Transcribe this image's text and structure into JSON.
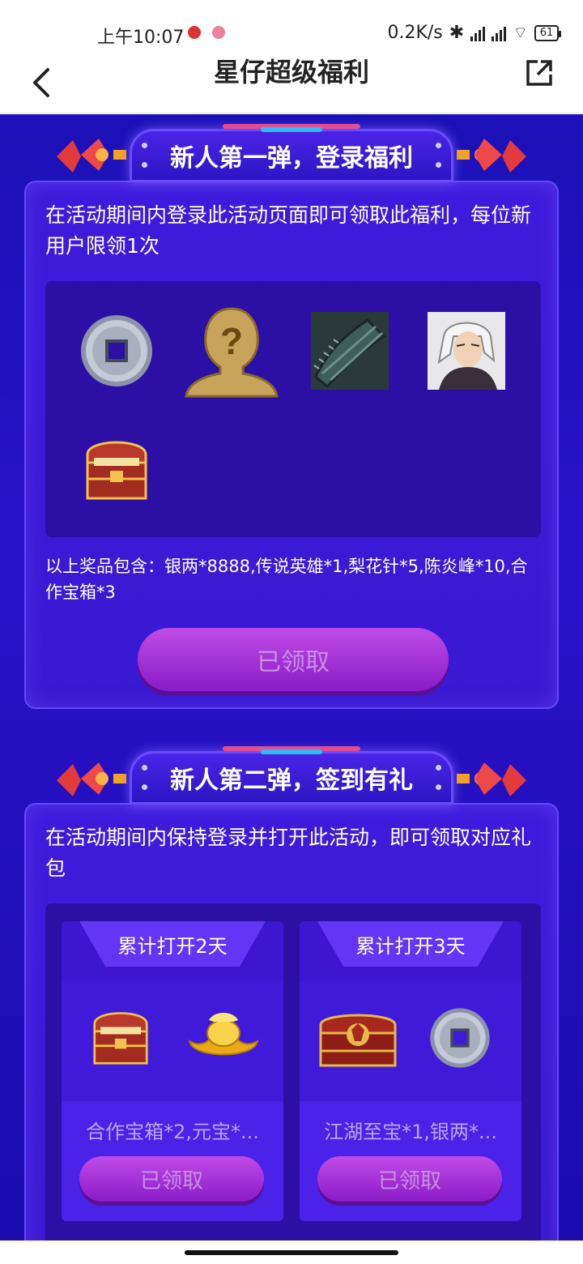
{
  "status_bar": {
    "time": "上午10:07",
    "network_speed": "0.2K/s",
    "battery": "61"
  },
  "nav": {
    "title": "星仔超级福利"
  },
  "section1": {
    "header": "新人第一弹，登录福利",
    "description": "在活动期间内登录此活动页面即可领取此福利，每位新用户限领1次",
    "prizes": [
      "silver-coin-icon",
      "mystery-hero-icon",
      "pear-blossom-needle-icon",
      "chen-yanfeng-portrait-icon",
      "coop-chest-icon"
    ],
    "prize_note": "以上奖品包含：银两*8888,传说英雄*1,梨花针*5,陈炎峰*10,合作宝箱*3",
    "button": "已领取"
  },
  "section2": {
    "header": "新人第二弹，签到有礼",
    "description": "在活动期间内保持登录并打开此活动，即可领取对应礼包",
    "days": [
      {
        "title": "累计打开2天",
        "items": [
          "coop-chest-icon",
          "gold-ingot-icon"
        ],
        "text": "合作宝箱*2,元宝*...",
        "button": "已领取"
      },
      {
        "title": "累计打开3天",
        "items": [
          "dragon-treasure-chest-icon",
          "silver-coin-icon"
        ],
        "text": "江湖至宝*1,银两*...",
        "button": "已领取"
      }
    ]
  },
  "colors": {
    "background": "#1b11b8",
    "card": "#3e1bdc",
    "button": "#a235d8",
    "button_text": "#c98fe4"
  }
}
